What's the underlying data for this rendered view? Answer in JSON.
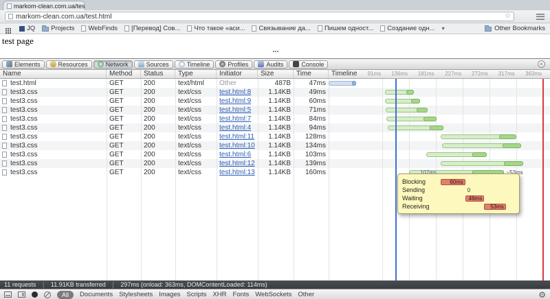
{
  "browser": {
    "tab_title": "markom-clean.com.ua/tes",
    "url": "markom-clean.com.ua/test.html",
    "bookmarks": [
      {
        "label": "JQ",
        "icon": "site"
      },
      {
        "label": "Projects",
        "icon": "folder"
      },
      {
        "label": "WebFinds",
        "icon": "page"
      },
      {
        "label": "[Перевод] Сов...",
        "icon": "page"
      },
      {
        "label": "Что такое «аси...",
        "icon": "page"
      },
      {
        "label": "Связывание да...",
        "icon": "page"
      },
      {
        "label": "Пишем одност...",
        "icon": "page"
      },
      {
        "label": "Создание одн...",
        "icon": "page"
      }
    ],
    "other_bookmarks_label": "Other Bookmarks"
  },
  "page": {
    "text": "test page"
  },
  "devtools": {
    "tabs": [
      {
        "label": "Elements",
        "icon": "elements"
      },
      {
        "label": "Resources",
        "icon": "resources"
      },
      {
        "label": "Network",
        "icon": "network"
      },
      {
        "label": "Sources",
        "icon": "sources"
      },
      {
        "label": "Timeline",
        "icon": "timeline"
      },
      {
        "label": "Profiles",
        "icon": "profiles"
      },
      {
        "label": "Audits",
        "icon": "audits"
      },
      {
        "label": "Console",
        "icon": "console"
      }
    ],
    "active_tab": "Network",
    "columns": [
      "Name",
      "Method",
      "Status",
      "Type",
      "Initiator",
      "Size",
      "Time",
      "Timeline"
    ],
    "time_ticks": [
      {
        "label": "91ms",
        "ms": 91
      },
      {
        "label": "136ms",
        "ms": 136
      },
      {
        "label": "181ms",
        "ms": 181
      },
      {
        "label": "227ms",
        "ms": 227
      },
      {
        "label": "272ms",
        "ms": 272
      },
      {
        "label": "317ms",
        "ms": 317
      },
      {
        "label": "363ms",
        "ms": 363
      }
    ],
    "events": [
      {
        "name": "DOMContentLoaded",
        "ms": 114,
        "color": "#3f6fd1"
      },
      {
        "name": "load",
        "ms": 363,
        "color": "#d63c3c"
      }
    ],
    "requests": [
      {
        "name": "test.html",
        "method": "GET",
        "status": "200",
        "type": "text/html",
        "initiator": {
          "label": "Other",
          "is_link": false
        },
        "size": "487B",
        "time": "47ms",
        "timeline": {
          "start": 0,
          "light": 40,
          "dark": 7,
          "color": "blue"
        }
      },
      {
        "name": "test3.css",
        "method": "GET",
        "status": "200",
        "type": "text/css",
        "initiator": {
          "label": "test.html:8",
          "is_link": true
        },
        "size": "1.14KB",
        "time": "49ms",
        "timeline": {
          "start": 95,
          "light": 36,
          "dark": 13,
          "color": "green"
        }
      },
      {
        "name": "test3.css",
        "method": "GET",
        "status": "200",
        "type": "text/css",
        "initiator": {
          "label": "test.html:9",
          "is_link": true
        },
        "size": "1.14KB",
        "time": "60ms",
        "timeline": {
          "start": 95,
          "light": 44,
          "dark": 16,
          "color": "green"
        }
      },
      {
        "name": "test3.css",
        "method": "GET",
        "status": "200",
        "type": "text/css",
        "initiator": {
          "label": "test.html:5",
          "is_link": true
        },
        "size": "1.14KB",
        "time": "71ms",
        "timeline": {
          "start": 96,
          "light": 53,
          "dark": 18,
          "color": "green"
        }
      },
      {
        "name": "test3.css",
        "method": "GET",
        "status": "200",
        "type": "text/css",
        "initiator": {
          "label": "test.html:7",
          "is_link": true
        },
        "size": "1.14KB",
        "time": "84ms",
        "timeline": {
          "start": 98,
          "light": 63,
          "dark": 21,
          "color": "green"
        }
      },
      {
        "name": "test3.css",
        "method": "GET",
        "status": "200",
        "type": "text/css",
        "initiator": {
          "label": "test.html:4",
          "is_link": true
        },
        "size": "1.14KB",
        "time": "94ms",
        "timeline": {
          "start": 100,
          "light": 71,
          "dark": 23,
          "color": "green"
        }
      },
      {
        "name": "test3.css",
        "method": "GET",
        "status": "200",
        "type": "text/css",
        "initiator": {
          "label": "test.html:11",
          "is_link": true
        },
        "size": "1.14KB",
        "time": "128ms",
        "timeline": {
          "start": 190,
          "light": 98,
          "dark": 30,
          "color": "green"
        }
      },
      {
        "name": "test3.css",
        "method": "GET",
        "status": "200",
        "type": "text/css",
        "initiator": {
          "label": "test.html:10",
          "is_link": true
        },
        "size": "1.14KB",
        "time": "134ms",
        "timeline": {
          "start": 192,
          "light": 102,
          "dark": 32,
          "color": "green"
        }
      },
      {
        "name": "test3.css",
        "method": "GET",
        "status": "200",
        "type": "text/css",
        "initiator": {
          "label": "test.html:6",
          "is_link": true
        },
        "size": "1.14KB",
        "time": "103ms",
        "timeline": {
          "start": 165,
          "light": 78,
          "dark": 25,
          "color": "green"
        }
      },
      {
        "name": "test3.css",
        "method": "GET",
        "status": "200",
        "type": "text/css",
        "initiator": {
          "label": "test.html:12",
          "is_link": true
        },
        "size": "1.14KB",
        "time": "139ms",
        "timeline": {
          "start": 190,
          "light": 106,
          "dark": 33,
          "color": "green"
        }
      },
      {
        "name": "test3.css",
        "method": "GET",
        "status": "200",
        "type": "text/css",
        "initiator": {
          "label": "test.html:13",
          "is_link": true
        },
        "size": "1.14KB",
        "time": "160ms",
        "timeline": {
          "start": 136,
          "light": 107,
          "dark": 53,
          "color": "green"
        },
        "hover_labels": {
          "inner": "107ms",
          "after": "~53ms"
        }
      }
    ],
    "tooltip": {
      "total_ms": 160,
      "rows": [
        {
          "label": "Blocking",
          "value": "60ms",
          "start": 0,
          "dur": 60
        },
        {
          "label": "Sending",
          "value": "0",
          "start": 60,
          "dur": 0
        },
        {
          "label": "Waiting",
          "value": "46ms",
          "start": 60,
          "dur": 46
        },
        {
          "label": "Receiving",
          "value": "53ms",
          "start": 106,
          "dur": 53
        }
      ]
    },
    "summary": {
      "requests": "11 requests",
      "transferred": "11.91KB transferred",
      "timing": "297ms (onload: 363ms, DOMContentLoaded: 114ms)"
    },
    "filters": {
      "all": "All",
      "items": [
        "Documents",
        "Stylesheets",
        "Images",
        "Scripts",
        "XHR",
        "Fonts",
        "WebSockets",
        "Other"
      ]
    }
  }
}
